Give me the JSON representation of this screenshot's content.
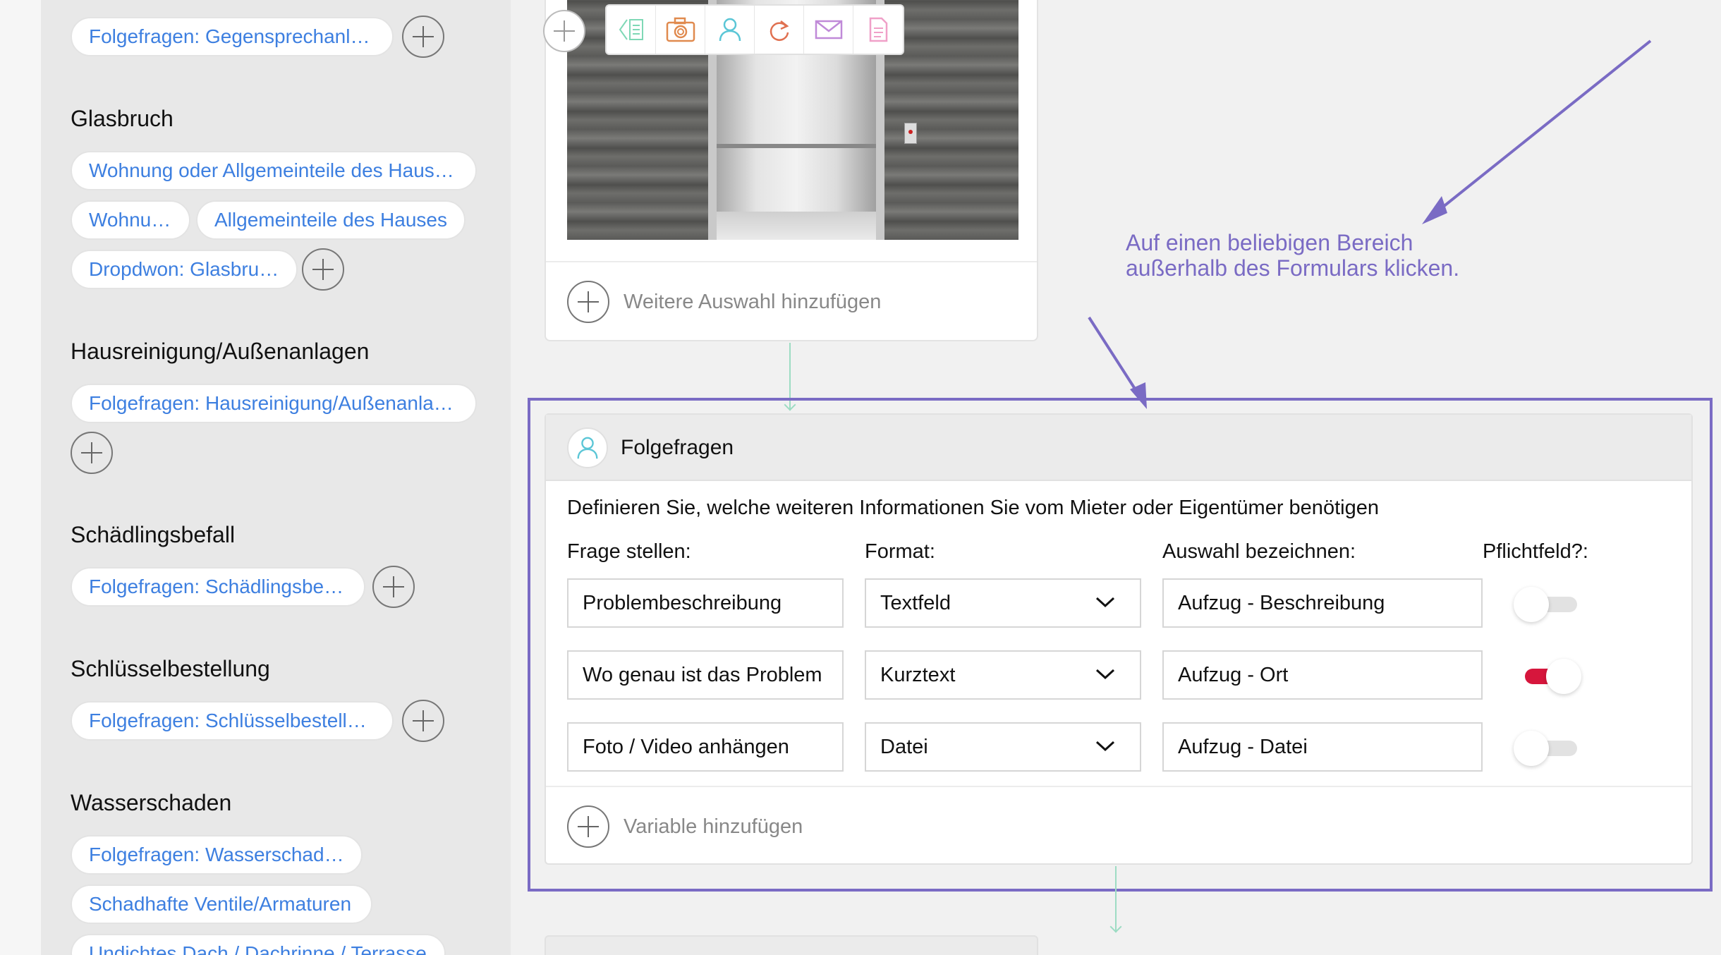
{
  "sidebar": {
    "sections": [
      {
        "heading": "",
        "chips": [
          "Folgefragen: Gegensprechanlage"
        ]
      },
      {
        "heading": "Glasbruch",
        "chips": [
          "Wohnung oder Allgemeinteile des Hause…",
          "Wohnung",
          "Allgemeinteile des Hauses",
          "Dropdwon: Glasbruch"
        ]
      },
      {
        "heading": "Hausreinigung/Außenanlagen",
        "chips": [
          "Folgefragen: Hausreinigung/Außenanlag…"
        ]
      },
      {
        "heading": "Schädlingsbefall",
        "chips": [
          "Folgefragen: Schädlingsbefall"
        ]
      },
      {
        "heading": "Schlüsselbestellung",
        "chips": [
          "Folgefragen: Schlüsselbestellung"
        ]
      },
      {
        "heading": "Wasserschaden",
        "chips": [
          "Folgefragen: Wasserschaden",
          "Schadhafte Ventile/Armaturen",
          "Undichtes Dach / Dachrinne / Terrasse"
        ]
      }
    ]
  },
  "top_card": {
    "toolbar_icons": [
      "list-arrow-icon",
      "camera-icon",
      "user-icon",
      "redo-icon",
      "mail-icon",
      "document-icon"
    ],
    "add_label": "Weitere Auswahl hinzufügen"
  },
  "folgefragen": {
    "title": "Folgefragen",
    "description": "Definieren Sie, welche weiteren Informationen Sie vom Mieter oder Eigentümer benötigen",
    "columns": [
      "Frage stellen:",
      "Format:",
      "Auswahl bezeichnen:",
      "Pflichtfeld?:"
    ],
    "rows": [
      {
        "question": "Problembeschreibung",
        "format": "Textfeld",
        "label": "Aufzug - Beschreibung",
        "required": false
      },
      {
        "question": "Wo genau ist das Problem",
        "format": "Kurztext",
        "label": "Aufzug - Ort",
        "required": true
      },
      {
        "question": "Foto / Video anhängen",
        "format": "Datei",
        "label": "Aufzug - Datei",
        "required": false
      }
    ],
    "add_label": "Variable hinzufügen"
  },
  "annotation": {
    "line1": "Auf einen beliebigen Bereich",
    "line2": "außerhalb des Formulars klicken."
  },
  "colors": {
    "accent_link": "#3d7fe0",
    "annotation": "#7a6bc4",
    "toggle_on": "#d6163c",
    "connector": "#9ddcc3"
  }
}
